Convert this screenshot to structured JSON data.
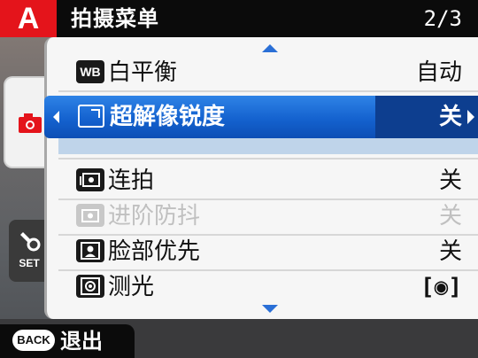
{
  "header": {
    "mode_letter": "A",
    "title": "拍摄菜单",
    "page": "2/3"
  },
  "tabs": [
    {
      "name": "shooting",
      "icon": "camera-icon",
      "active": true
    },
    {
      "name": "setup",
      "icon": "wrench-icon",
      "label": "SET",
      "active": false
    }
  ],
  "menu": {
    "items": [
      {
        "icon_text": "WB",
        "label": "白平衡",
        "value": "自动",
        "disabled": false
      },
      {
        "icon": "super-resolution-icon",
        "label": "超解像锐度",
        "value": "关",
        "selected": true
      },
      {
        "icon": "continuous-shooting-icon",
        "label": "连拍",
        "value": "关",
        "disabled": false
      },
      {
        "icon": "bracketing-icon",
        "label": "进阶防抖",
        "value": "关",
        "disabled": true
      },
      {
        "icon": "face-detection-icon",
        "label": "脸部优先",
        "value": "关",
        "disabled": false
      },
      {
        "icon": "metering-icon",
        "label": "测光",
        "value": "[◉]",
        "disabled": false
      }
    ]
  },
  "footer": {
    "back_key": "BACK",
    "back_label": "退出"
  },
  "colors": {
    "mode_red": "#e4141b",
    "highlight_blue": "#1462cf",
    "scroll_arrow": "#2a6fd6"
  }
}
